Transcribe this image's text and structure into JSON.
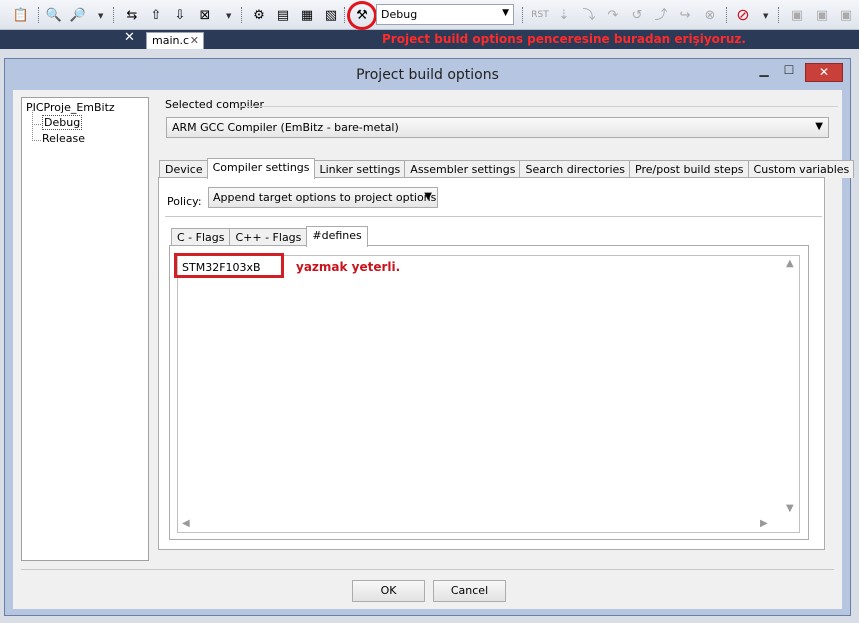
{
  "toolbar": {
    "target": "Debug"
  },
  "editor": {
    "tab_label": "main.c",
    "close_glyph": "✕"
  },
  "annotations": {
    "toolbar_note": "Project build options penceresine buradan erişiyoruz.",
    "defines_note": "yazmak yeterli."
  },
  "dialog": {
    "title": "Project build options",
    "tree": {
      "root": "PICProje_EmBitz",
      "children": [
        "Debug",
        "Release"
      ]
    },
    "selected_compiler_label": "Selected compiler",
    "compiler": "ARM GCC Compiler (EmBitz - bare-metal)",
    "tabs": [
      "Device",
      "Compiler settings",
      "Linker settings",
      "Assembler settings",
      "Search directories",
      "Pre/post build steps",
      "Custom variables"
    ],
    "active_tab": "Compiler settings",
    "policy_label": "Policy:",
    "policy_value": "Append target options to project options",
    "inner_tabs": [
      "C - Flags",
      "C++ - Flags",
      "#defines"
    ],
    "active_inner_tab": "#defines",
    "defines_text": "STM32F103xB",
    "ok_label": "OK",
    "cancel_label": "Cancel"
  },
  "colors": {
    "annotation_red": "#e0141c",
    "dialog_frame": "#b6c5e0",
    "close_button": "#c9403a"
  }
}
